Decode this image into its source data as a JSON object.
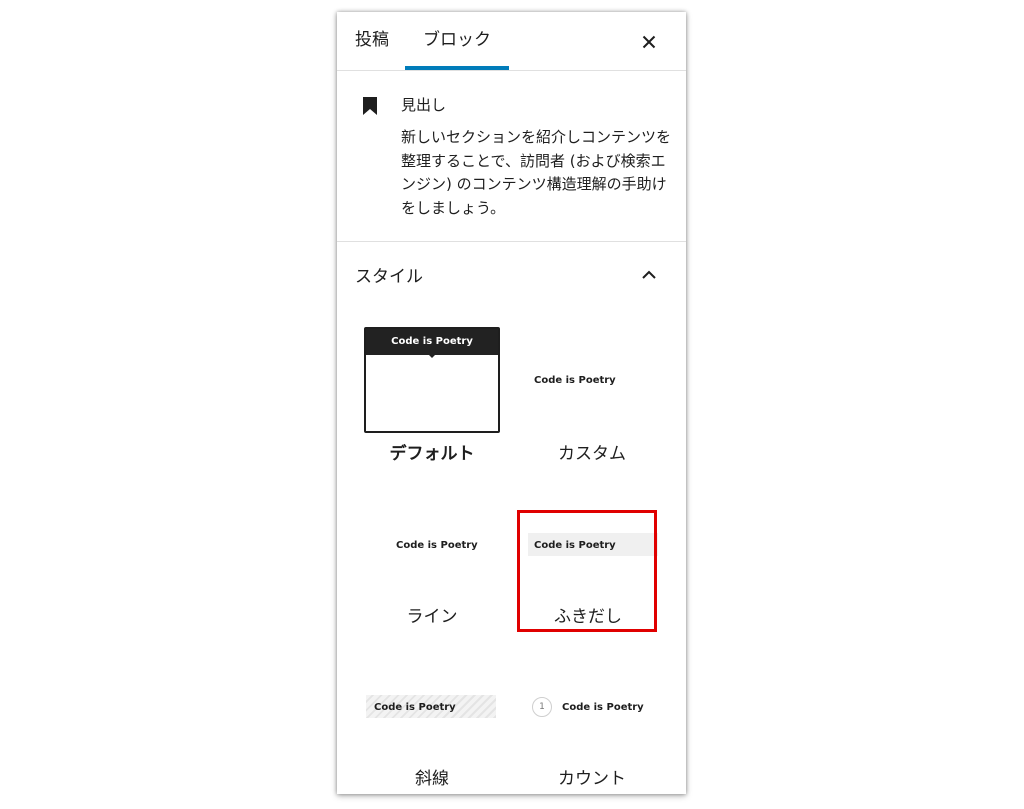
{
  "tabs": {
    "post_label": "投稿",
    "block_label": "ブロック",
    "accent_color": "#007cba"
  },
  "icons": {
    "close": "close-icon",
    "bookmark": "bookmark-icon",
    "chevron": "chevron-up-icon"
  },
  "block_card": {
    "title": "見出し",
    "description": "新しいセクションを紹介しコンテンツを整理することで、訪問者 (および検索エンジン) のコンテンツ構造理解の手助けをしましょう。"
  },
  "styles": {
    "header": "スタイル",
    "preview_text": "Code is Poetry",
    "highlight_color": "#e00000",
    "items": [
      {
        "label": "デフォルト",
        "selected": true
      },
      {
        "label": "カスタム"
      },
      {
        "label": "ライン"
      },
      {
        "label": "ふきだし"
      },
      {
        "label": "斜線"
      },
      {
        "label": "カウント",
        "count": "1"
      }
    ]
  }
}
